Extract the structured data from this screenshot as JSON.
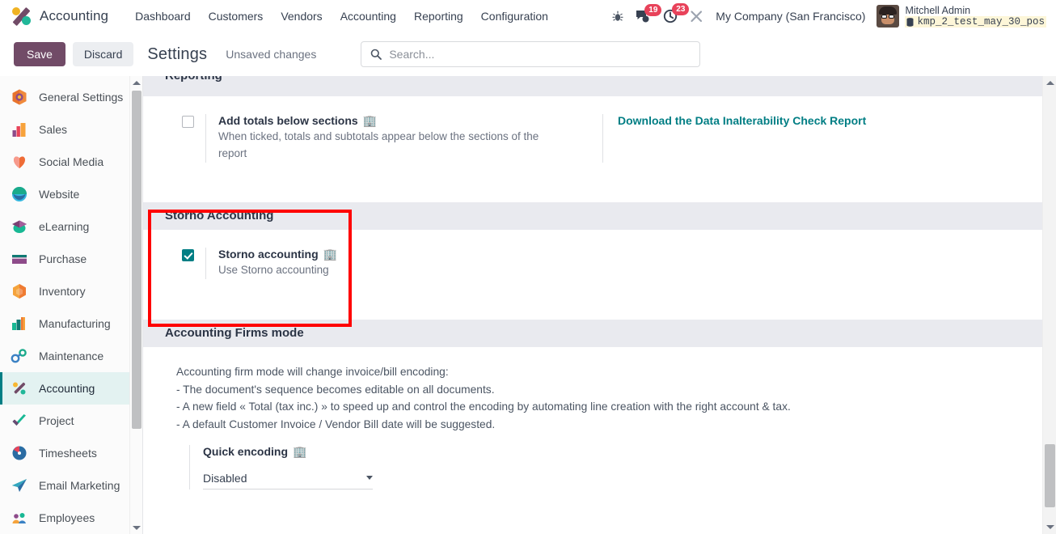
{
  "navbar": {
    "brand": "Accounting",
    "brand_icon": "odoo-accounting-logo-icon",
    "menu": [
      {
        "label": "Dashboard"
      },
      {
        "label": "Customers"
      },
      {
        "label": "Vendors"
      },
      {
        "label": "Accounting"
      },
      {
        "label": "Reporting"
      },
      {
        "label": "Configuration"
      }
    ],
    "icons": {
      "debug": "bug-icon",
      "messages": "chat-bubble-icon",
      "activities": "clock-icon",
      "tools": "crossed-tools-icon"
    },
    "messages_count": "19",
    "activities_count": "23",
    "company": "My Company (San Francisco)",
    "user_name": "Mitchell Admin",
    "database": "kmp_2_test_may_30_pos",
    "database_icon": "database-icon",
    "avatar": "user-avatar"
  },
  "controlbar": {
    "save_label": "Save",
    "discard_label": "Discard",
    "title": "Settings",
    "status": "Unsaved changes",
    "search_placeholder": "Search...",
    "search_value": "",
    "search_icon": "search-icon"
  },
  "sidebar": {
    "items": [
      {
        "label": "General Settings",
        "icon": "settings-app-icon",
        "active": false
      },
      {
        "label": "Sales",
        "icon": "sales-app-icon",
        "active": false
      },
      {
        "label": "Social Media",
        "icon": "social-media-app-icon",
        "active": false
      },
      {
        "label": "Website",
        "icon": "website-app-icon",
        "active": false
      },
      {
        "label": "eLearning",
        "icon": "elearning-app-icon",
        "active": false
      },
      {
        "label": "Purchase",
        "icon": "purchase-app-icon",
        "active": false
      },
      {
        "label": "Inventory",
        "icon": "inventory-app-icon",
        "active": false
      },
      {
        "label": "Manufacturing",
        "icon": "manufacturing-app-icon",
        "active": false
      },
      {
        "label": "Maintenance",
        "icon": "maintenance-app-icon",
        "active": false
      },
      {
        "label": "Accounting",
        "icon": "accounting-app-icon",
        "active": true
      },
      {
        "label": "Project",
        "icon": "project-app-icon",
        "active": false
      },
      {
        "label": "Timesheets",
        "icon": "timesheets-app-icon",
        "active": false
      },
      {
        "label": "Email Marketing",
        "icon": "email-marketing-app-icon",
        "active": false
      },
      {
        "label": "Employees",
        "icon": "employees-app-icon",
        "active": false
      }
    ]
  },
  "sections": {
    "reporting": {
      "header": "Reporting",
      "setting": {
        "title": "Add totals below sections",
        "company_icon": "🏢",
        "description": "When ticked, totals and subtotals appear below the sections of the report",
        "checked": false
      },
      "link": "Download the Data Inalterability Check Report"
    },
    "storno": {
      "header": "Storno Accounting",
      "setting": {
        "title": "Storno accounting",
        "company_icon": "🏢",
        "description": "Use Storno accounting",
        "checked": true
      },
      "highlight_color": "#ff0000"
    },
    "firms": {
      "header": "Accounting Firms mode",
      "lines": [
        "Accounting firm mode will change invoice/bill encoding:",
        "- The document's sequence becomes editable on all documents.",
        "- A new field « Total (tax inc.) » to speed up and control the encoding by automating line creation with the right account & tax.",
        "- A default Customer Invoice / Vendor Bill date will be suggested."
      ],
      "quick_encoding_label": "Quick encoding",
      "quick_encoding_icon": "🏢",
      "quick_encoding_value": "Disabled"
    }
  },
  "colors": {
    "brand_purple": "#714b67",
    "accent_teal": "#017e84",
    "badge_red": "#e8425a",
    "annotation_red": "#ff0000",
    "section_header_bg": "#e9eaef"
  }
}
